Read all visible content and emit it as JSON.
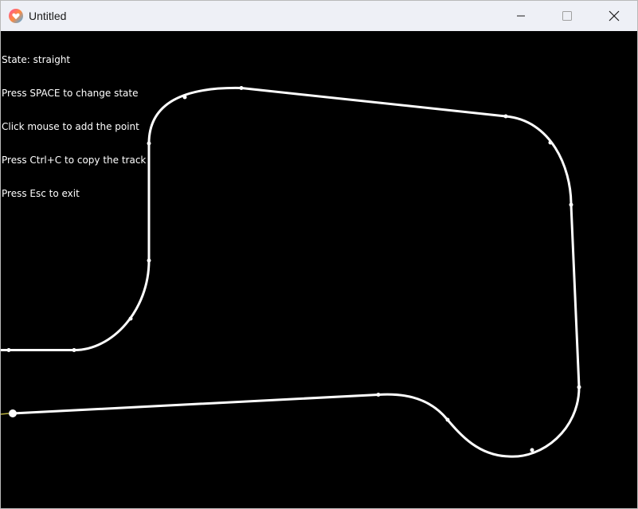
{
  "window": {
    "title": "Untitled",
    "app_icon": "heart-app-icon",
    "controls": [
      "minimize-icon",
      "maximize-icon",
      "close-icon"
    ]
  },
  "hud": {
    "state_line": "State: straight",
    "help_lines": [
      "Press SPACE to change state",
      "Click mouse to add the point",
      "Press Ctrl+C to copy the track",
      "Press Esc to exit"
    ]
  },
  "colors": {
    "canvas_bg": "#000000",
    "track": "#ffffff",
    "titlebar_bg": "#eef0f6"
  }
}
